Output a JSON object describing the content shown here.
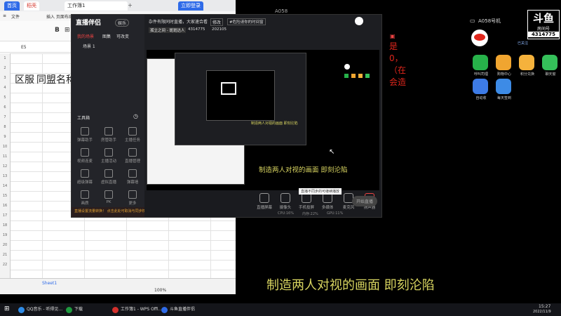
{
  "wps": {
    "tab_home": "首页",
    "tab_dao": "稻壳",
    "tab_file": "工作簿1",
    "login": "立即登录",
    "menu_file": "文件",
    "menu_rest": "插入 页面布局 公",
    "cellref": "E5",
    "cell_a2": "区服",
    "cell_b2": "同盟名称",
    "row_labels": [
      "1",
      "2",
      "3",
      "4",
      "5",
      "6",
      "7",
      "8",
      "9",
      "10",
      "11",
      "12",
      "13",
      "14",
      "15",
      "16",
      "17",
      "18",
      "19",
      "20",
      "21",
      "22"
    ],
    "sheet_tab": "Sheet1",
    "zoom": "100%"
  },
  "douyu": {
    "brand": "直播伴侣",
    "channel": "娱乐",
    "scene_tab": "我的场景",
    "scene_tab2": "图集",
    "scene_tab3": "可改变",
    "scene_item": "场景 1",
    "room_title": "杂件有限同时直播，大家速合看",
    "modify": "修改",
    "room_badge": "#危险请你的时间窗",
    "room_name": "孤立之间 - 斑斑达人",
    "room_id": "4314775",
    "date_short": "202105",
    "toolbox_title": "工具箱",
    "tools": [
      "弹幕助手",
      "房管助手",
      "主播任务",
      "视频连麦",
      "主播活动",
      "直播管理",
      "超级弹幕",
      "虚拟直播",
      "弹幕墙",
      "画质",
      "PK",
      "更多"
    ],
    "bottom_notice": "直播设置流量转换！ 点击此处可取消与同步权限",
    "bottom_buttons": [
      "直播屏幕",
      "摄像头",
      "手机投屏",
      "多媒体",
      "麦克风",
      "扬声器"
    ],
    "tooltip": "直播不同步的可继续播放",
    "start_live": "开始直播",
    "stats": [
      "CPU:16%",
      "内存:22%",
      "GPU:11%"
    ]
  },
  "preview": {
    "mini_caption": "制造两人对视的画面 即刻沦陷",
    "caption": "制造两人对视的画面 即刻沦陷",
    "red_lines": [
      "是",
      "0，",
      "（在",
      "会造"
    ]
  },
  "right_panel": {
    "room_label": "A058号机",
    "top_label": "A058",
    "douyu_logo": "斗鱼",
    "room_number_label": "房间号",
    "room_number": "4314775",
    "follow": "已关注",
    "apps": [
      "呼叫司理",
      "购物中心",
      "积分兑换",
      "聊天窗",
      "自动收",
      "每天签到"
    ],
    "app_colors": [
      "#27b24a",
      "#f0a530",
      "#f5b23c",
      "#35c05a",
      "#3d7be6",
      "#3d8be6"
    ]
  },
  "taskbar": {
    "items": [
      "QQ音乐 - 听得见...",
      "下载",
      "工作簿1 - WPS Offi...",
      "斗鱼直播伴侣"
    ],
    "item_colors": [
      "#2e8be6",
      "#1f9a3f",
      "#d2302c",
      "#2f6be8"
    ],
    "time": "15:27",
    "date": "2022/11/9"
  }
}
